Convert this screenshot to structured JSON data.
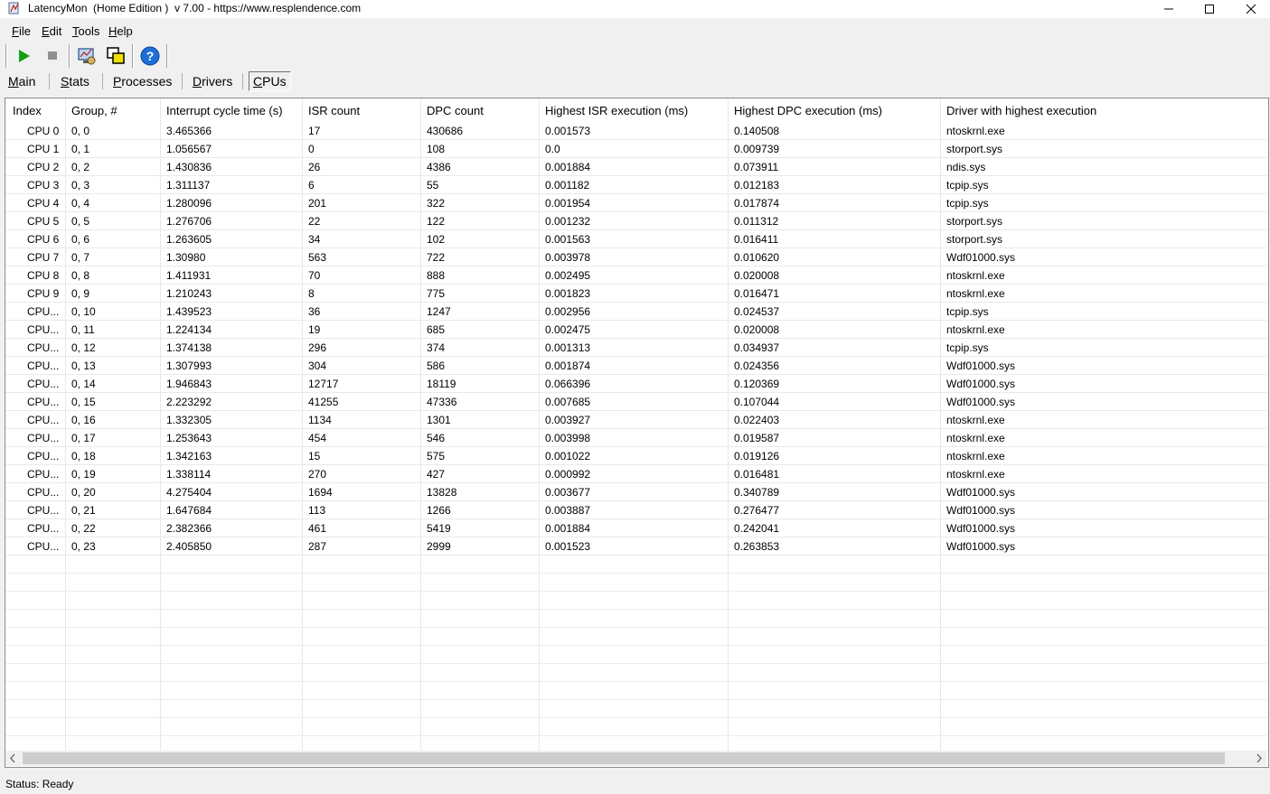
{
  "window": {
    "title": "LatencyMon  (Home Edition )  v 7.00 - https://www.resplendence.com"
  },
  "menu": {
    "items": [
      {
        "first": "F",
        "rest": "ile"
      },
      {
        "first": "E",
        "rest": "dit"
      },
      {
        "first": "T",
        "rest": "ools"
      },
      {
        "first": "H",
        "rest": "elp"
      }
    ]
  },
  "toolbar": {
    "icons": [
      "play-icon",
      "stop-icon",
      "monitor-icon",
      "windows-icon",
      "help-icon"
    ],
    "play_color": "#14a014",
    "stop_color": "#909090",
    "help_color": "#1e6fd9"
  },
  "tabs": [
    {
      "first": "M",
      "rest": "ain"
    },
    {
      "first": "S",
      "rest": "tats"
    },
    {
      "first": "P",
      "rest": "rocesses"
    },
    {
      "first": "D",
      "rest": "rivers"
    },
    {
      "first": "C",
      "rest": "PUs"
    }
  ],
  "active_tab": 4,
  "grid": {
    "headers": [
      "Index",
      "Group, #",
      "Interrupt cycle time (s)",
      "ISR count",
      "DPC count",
      "Highest ISR execution (ms)",
      "Highest DPC execution (ms)",
      "Driver with highest execution"
    ],
    "rows": [
      [
        "CPU 0",
        "0, 0",
        "3.465366",
        "17",
        "430686",
        "0.001573",
        "0.140508",
        "ntoskrnl.exe"
      ],
      [
        "CPU 1",
        "0, 1",
        "1.056567",
        "0",
        "108",
        "0.0",
        "0.009739",
        "storport.sys"
      ],
      [
        "CPU 2",
        "0, 2",
        "1.430836",
        "26",
        "4386",
        "0.001884",
        "0.073911",
        "ndis.sys"
      ],
      [
        "CPU 3",
        "0, 3",
        "1.311137",
        "6",
        "55",
        "0.001182",
        "0.012183",
        "tcpip.sys"
      ],
      [
        "CPU 4",
        "0, 4",
        "1.280096",
        "201",
        "322",
        "0.001954",
        "0.017874",
        "tcpip.sys"
      ],
      [
        "CPU 5",
        "0, 5",
        "1.276706",
        "22",
        "122",
        "0.001232",
        "0.011312",
        "storport.sys"
      ],
      [
        "CPU 6",
        "0, 6",
        "1.263605",
        "34",
        "102",
        "0.001563",
        "0.016411",
        "storport.sys"
      ],
      [
        "CPU 7",
        "0, 7",
        "1.30980",
        "563",
        "722",
        "0.003978",
        "0.010620",
        "Wdf01000.sys"
      ],
      [
        "CPU 8",
        "0, 8",
        "1.411931",
        "70",
        "888",
        "0.002495",
        "0.020008",
        "ntoskrnl.exe"
      ],
      [
        "CPU 9",
        "0, 9",
        "1.210243",
        "8",
        "775",
        "0.001823",
        "0.016471",
        "ntoskrnl.exe"
      ],
      [
        "CPU...",
        "0, 10",
        "1.439523",
        "36",
        "1247",
        "0.002956",
        "0.024537",
        "tcpip.sys"
      ],
      [
        "CPU...",
        "0, 11",
        "1.224134",
        "19",
        "685",
        "0.002475",
        "0.020008",
        "ntoskrnl.exe"
      ],
      [
        "CPU...",
        "0, 12",
        "1.374138",
        "296",
        "374",
        "0.001313",
        "0.034937",
        "tcpip.sys"
      ],
      [
        "CPU...",
        "0, 13",
        "1.307993",
        "304",
        "586",
        "0.001874",
        "0.024356",
        "Wdf01000.sys"
      ],
      [
        "CPU...",
        "0, 14",
        "1.946843",
        "12717",
        "18119",
        "0.066396",
        "0.120369",
        "Wdf01000.sys"
      ],
      [
        "CPU...",
        "0, 15",
        "2.223292",
        "41255",
        "47336",
        "0.007685",
        "0.107044",
        "Wdf01000.sys"
      ],
      [
        "CPU...",
        "0, 16",
        "1.332305",
        "1134",
        "1301",
        "0.003927",
        "0.022403",
        "ntoskrnl.exe"
      ],
      [
        "CPU...",
        "0, 17",
        "1.253643",
        "454",
        "546",
        "0.003998",
        "0.019587",
        "ntoskrnl.exe"
      ],
      [
        "CPU...",
        "0, 18",
        "1.342163",
        "15",
        "575",
        "0.001022",
        "0.019126",
        "ntoskrnl.exe"
      ],
      [
        "CPU...",
        "0, 19",
        "1.338114",
        "270",
        "427",
        "0.000992",
        "0.016481",
        "ntoskrnl.exe"
      ],
      [
        "CPU...",
        "0, 20",
        "4.275404",
        "1694",
        "13828",
        "0.003677",
        "0.340789",
        "Wdf01000.sys"
      ],
      [
        "CPU...",
        "0, 21",
        "1.647684",
        "113",
        "1266",
        "0.003887",
        "0.276477",
        "Wdf01000.sys"
      ],
      [
        "CPU...",
        "0, 22",
        "2.382366",
        "461",
        "5419",
        "0.001884",
        "0.242041",
        "Wdf01000.sys"
      ],
      [
        "CPU...",
        "0, 23",
        "2.405850",
        "287",
        "2999",
        "0.001523",
        "0.263853",
        "Wdf01000.sys"
      ]
    ]
  },
  "status": {
    "text": "Status: Ready"
  }
}
